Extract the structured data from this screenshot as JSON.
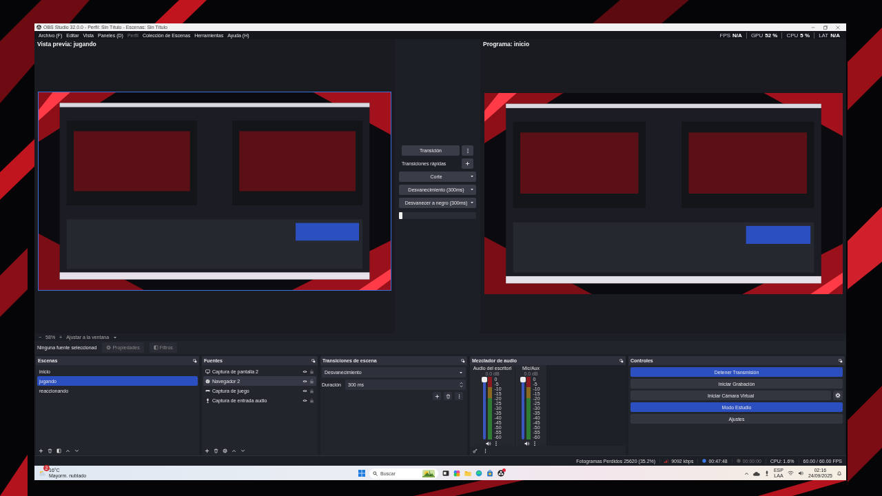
{
  "window": {
    "title": "OBS Studio 32.0.0 - Perfil: Sin Título - Escenas: Sin Título"
  },
  "menu": [
    {
      "label": "Archivo (F)",
      "disabled": false
    },
    {
      "label": "Editar",
      "disabled": false
    },
    {
      "label": "Vista",
      "disabled": false
    },
    {
      "label": "Paneles (D)",
      "disabled": false
    },
    {
      "label": "Perfil",
      "disabled": true
    },
    {
      "label": "Colección de Escenas",
      "disabled": false
    },
    {
      "label": "Herramientas",
      "disabled": false
    },
    {
      "label": "Ayuda (H)",
      "disabled": false
    }
  ],
  "stats": [
    {
      "label": "FPS",
      "value": "N/A"
    },
    {
      "label": "GPU",
      "value": "52 %"
    },
    {
      "label": "CPU",
      "value": "5 %"
    },
    {
      "label": "LAT",
      "value": "N/A"
    }
  ],
  "preview": {
    "title": "Vista previa: jugando",
    "kind": "picture"
  },
  "program": {
    "title": "Programa: inicio",
    "kind": "picture"
  },
  "transition_panel": {
    "button": "Transición",
    "quick_label": "Transiciones rápidas",
    "quick": [
      {
        "label": "Corte"
      },
      {
        "label": "Desvanecimiento (300ms)"
      },
      {
        "label": "Desvanecer a negro (300ms)"
      }
    ],
    "tbar": {
      "level": 0
    }
  },
  "zoom_bar": {
    "minus": "−",
    "value": "58%",
    "plus": "+",
    "fit": "Ajustar a la ventana"
  },
  "context_bar": {
    "label": "Ninguna fuente seleccionad",
    "buttons": [
      {
        "label": "Propiedades",
        "kind": "properties",
        "disabled": true
      },
      {
        "label": "Filtros",
        "kind": "filters",
        "disabled": true
      }
    ]
  },
  "scenes": {
    "title": "Escenas",
    "items": [
      {
        "name": "inicio",
        "selected": false
      },
      {
        "name": "jugando",
        "selected": true
      },
      {
        "name": "reaccionando",
        "selected": false
      }
    ]
  },
  "sources": {
    "title": "Fuentes",
    "items": [
      {
        "name": "Captura de pantalla 2",
        "kind": "display",
        "visible": true,
        "locked": false,
        "selected": false
      },
      {
        "name": "Navegador 2",
        "kind": "browser",
        "visible": true,
        "locked": false,
        "selected": true
      },
      {
        "name": "Captura de juego",
        "kind": "game",
        "visible": true,
        "locked": false,
        "selected": false
      },
      {
        "name": "Captura de entrada audio",
        "kind": "audio",
        "visible": true,
        "locked": false,
        "selected": false
      }
    ]
  },
  "transitions": {
    "title": "Transiciones de escena",
    "value": "Desvanecimiento",
    "duration_label": "Duración",
    "duration": "300 ms"
  },
  "mixer": {
    "title": "Mezclador de audio",
    "channels": [
      {
        "name": "Audio del escritori",
        "volume": "0.0 dB",
        "level": 1,
        "muted": false,
        "scale": [
          "0",
          "-5",
          "-10",
          "-15",
          "-20",
          "-25",
          "-30",
          "-35",
          "-40",
          "-45",
          "-50",
          "-55",
          "-60"
        ]
      },
      {
        "name": "Mic/Aux",
        "volume": "0.0 dB",
        "level": 1,
        "muted": false,
        "scale": [
          "0",
          "-5",
          "-10",
          "-15",
          "-20",
          "-25",
          "-30",
          "-35",
          "-40",
          "-45",
          "-50",
          "-55",
          "-60"
        ]
      }
    ]
  },
  "controls": {
    "title": "Controles",
    "buttons": [
      {
        "label": "Detener Transmisión",
        "active": true,
        "settings": false
      },
      {
        "label": "Iniciar Grabación",
        "active": false,
        "settings": false
      },
      {
        "label": "Iniciar Cámara Virtual",
        "active": false,
        "settings": true
      },
      {
        "label": "Modo Estudio",
        "active": true,
        "settings": false
      },
      {
        "label": "Ajustes",
        "active": false,
        "settings": false
      }
    ]
  },
  "status_bar": {
    "dropped": "Fotogramas Perdidos 25620 (35.2%)",
    "bitrate": "9092 kbps",
    "stream_time": "00:47:48",
    "streaming": true,
    "record_time": "00:00:00",
    "recording": false,
    "cpu": "CPU: 1.6%",
    "fps": "60.00 / 60.00 FPS"
  },
  "taskbar": {
    "weather_badge": "2",
    "temperature": "16°C",
    "weather": "Mayorm. nublado",
    "search": "Buscar",
    "language": "ESP",
    "layout": "LAA",
    "time": "02:16",
    "date": "24/09/2025"
  }
}
